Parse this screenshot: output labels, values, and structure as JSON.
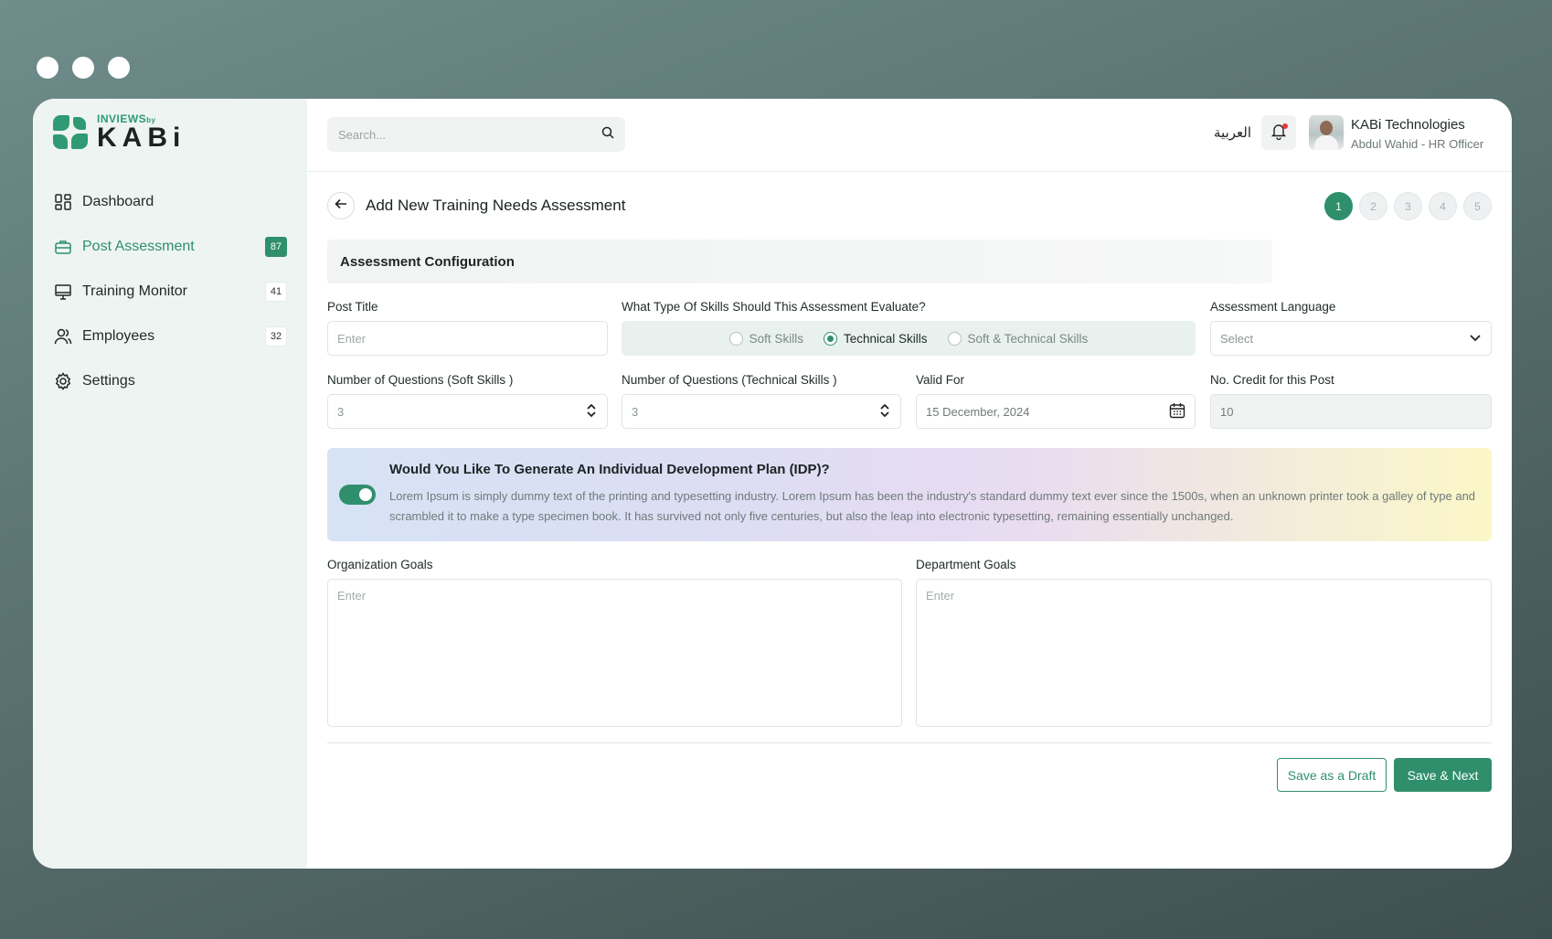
{
  "brand": {
    "top": "INVIEWS",
    "by": "by",
    "main": "KABi",
    "color": "#2f8f6d"
  },
  "sidebar": {
    "items": [
      {
        "label": "Dashboard",
        "icon": "dashboard-icon",
        "badge": null,
        "active": false
      },
      {
        "label": "Post Assessment",
        "icon": "briefcase-icon",
        "badge": "87",
        "active": true
      },
      {
        "label": "Training Monitor",
        "icon": "monitor-icon",
        "badge": "41",
        "active": false
      },
      {
        "label": "Employees",
        "icon": "users-icon",
        "badge": "32",
        "active": false
      },
      {
        "label": "Settings",
        "icon": "gear-icon",
        "badge": null,
        "active": false
      }
    ]
  },
  "header": {
    "search_placeholder": "Search...",
    "language_switch": "العربية",
    "user_name": "KABi Technologies",
    "user_role": "Abdul Wahid - HR Officer"
  },
  "page": {
    "title": "Add New Training Needs Assessment",
    "steps": [
      "1",
      "2",
      "3",
      "4",
      "5"
    ],
    "active_step": 1,
    "section_title": "Assessment Configuration"
  },
  "form": {
    "post_title": {
      "label": "Post Title",
      "placeholder": "Enter"
    },
    "skills_type": {
      "label": "What Type Of Skills Should This Assessment Evaluate?",
      "options": [
        "Soft Skills",
        "Technical Skills",
        "Soft & Technical Skills"
      ],
      "selected": "Technical Skills"
    },
    "language": {
      "label": "Assessment Language",
      "placeholder": "Select"
    },
    "soft_questions": {
      "label": "Number of Questions (Soft Skills )",
      "value": "3"
    },
    "tech_questions": {
      "label": "Number of Questions (Technical Skills )",
      "value": "3"
    },
    "valid_for": {
      "label": "Valid For",
      "value": "15 December, 2024"
    },
    "credits": {
      "label": "No. Credit for this Post",
      "value": "10"
    },
    "idp": {
      "title": "Would You Like To Generate An Individual Development Plan (IDP)?",
      "text": "Lorem Ipsum is simply dummy text of the printing and typesetting industry. Lorem Ipsum has been the industry's standard dummy text ever since the 1500s, when an unknown printer took a galley of type and scrambled it to make a type specimen book. It has survived not only five centuries, but also the leap into electronic typesetting, remaining essentially unchanged.",
      "enabled": true
    },
    "org_goals": {
      "label": "Organization Goals",
      "placeholder": "Enter"
    },
    "dept_goals": {
      "label": "Department Goals",
      "placeholder": "Enter"
    }
  },
  "actions": {
    "draft": "Save as a Draft",
    "next": "Save & Next"
  }
}
